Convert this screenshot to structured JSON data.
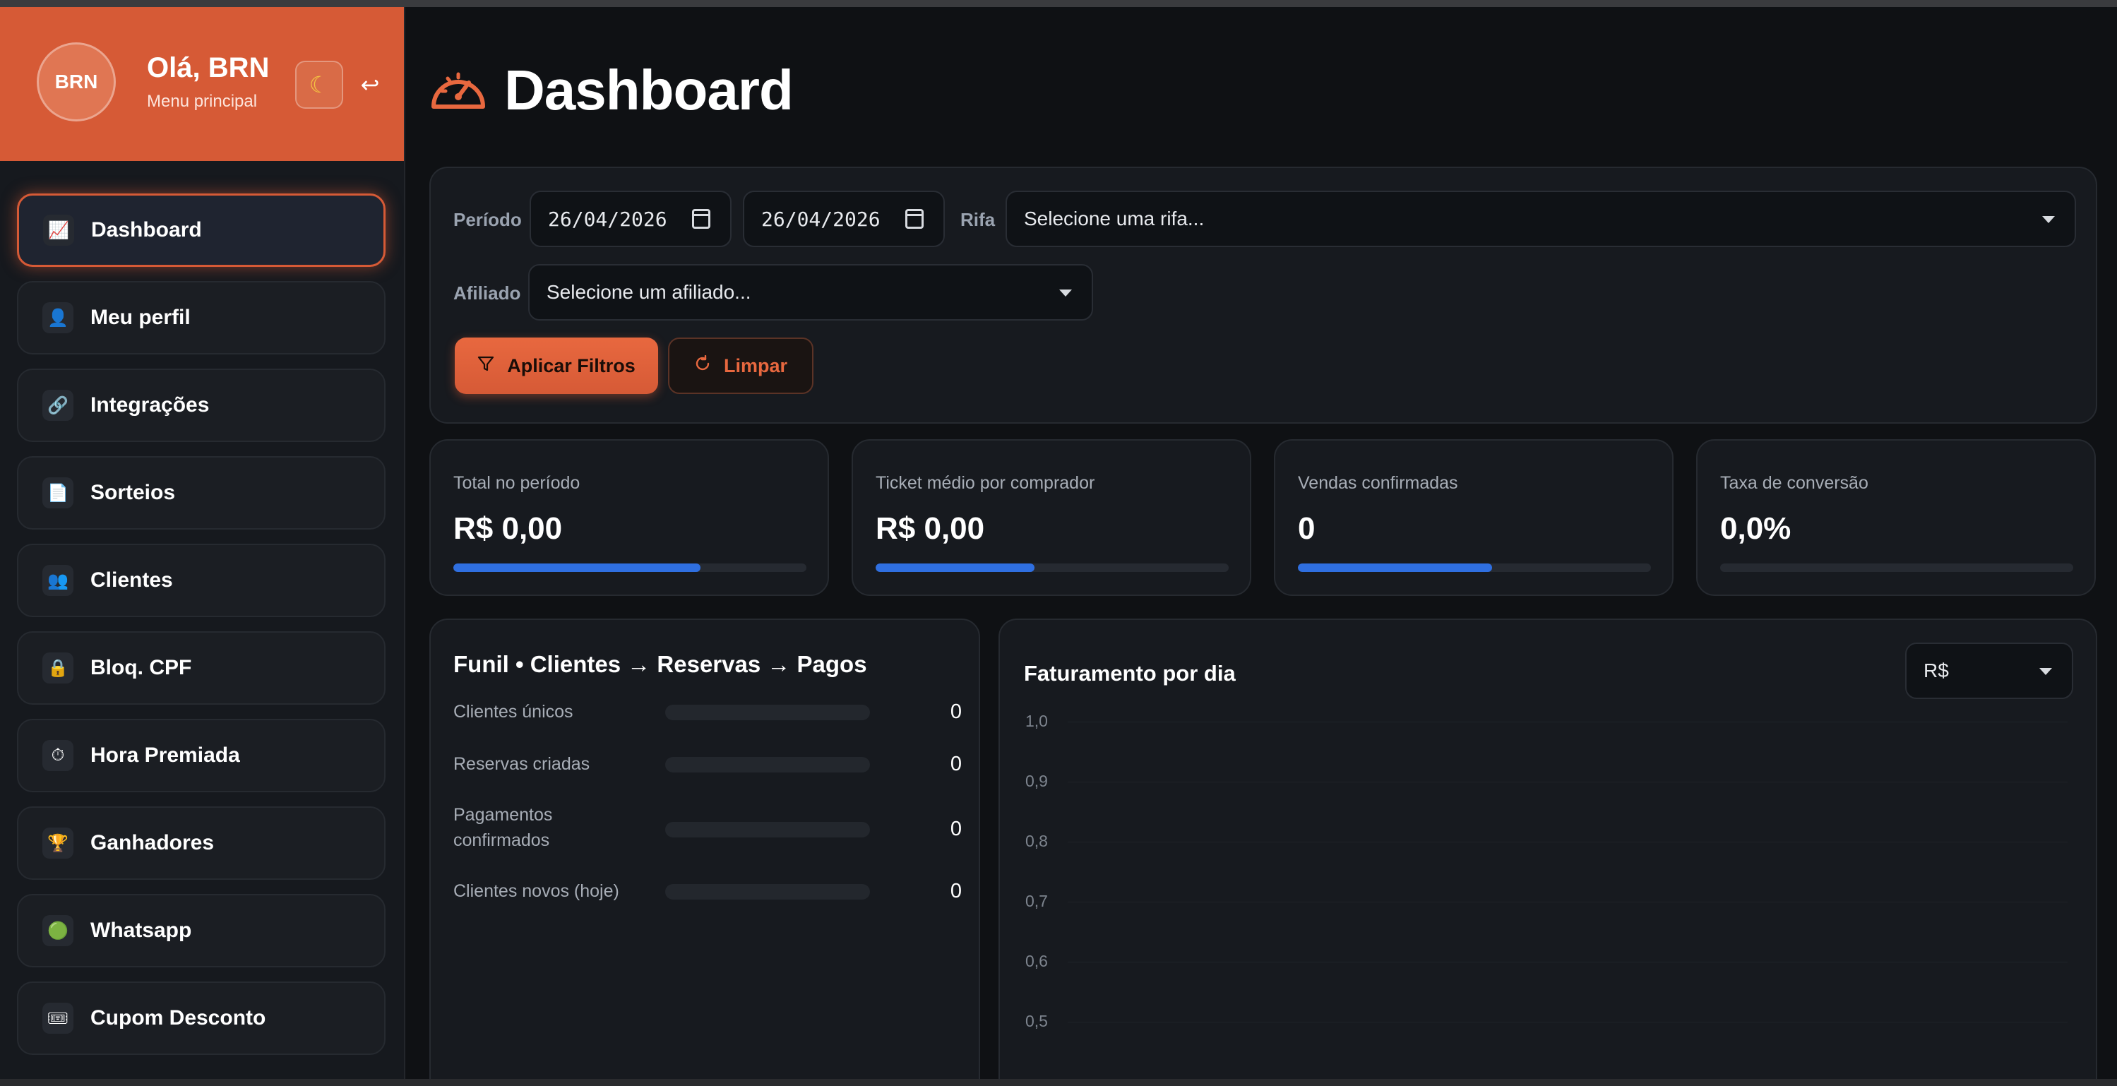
{
  "sidebar": {
    "avatar_initials": "BRN",
    "greeting": "Olá, BRN",
    "subtitle": "Menu principal",
    "theme_icon": "moon-icon",
    "logout_icon": "return-arrow-icon",
    "items": [
      {
        "label": "Dashboard",
        "icon": "chart-icon",
        "glyph": "📈",
        "active": true
      },
      {
        "label": "Meu perfil",
        "icon": "user-icon",
        "glyph": "👤"
      },
      {
        "label": "Integrações",
        "icon": "link-icon",
        "glyph": "🔗"
      },
      {
        "label": "Sorteios",
        "icon": "document-icon",
        "glyph": "📄"
      },
      {
        "label": "Clientes",
        "icon": "users-icon",
        "glyph": "👥"
      },
      {
        "label": "Bloq. CPF",
        "icon": "lock-icon",
        "glyph": "🔒"
      },
      {
        "label": "Hora Premiada",
        "icon": "stopwatch-icon",
        "glyph": "⏱"
      },
      {
        "label": "Ganhadores",
        "icon": "trophy-icon",
        "glyph": "🏆"
      },
      {
        "label": "Whatsapp",
        "icon": "green-circle-icon",
        "glyph": "🟢"
      },
      {
        "label": "Cupom Desconto",
        "icon": "ticket-icon",
        "glyph": "🎟"
      }
    ]
  },
  "header": {
    "title": "Dashboard",
    "icon": "speedometer-icon"
  },
  "filters": {
    "period_label": "Período",
    "date_start": "26/04/2026",
    "date_end": "26/04/2026",
    "raffle_label": "Rifa",
    "raffle_placeholder": "Selecione uma rifa...",
    "affiliate_label": "Afiliado",
    "affiliate_placeholder": "Selecione um afiliado...",
    "apply_label": "Aplicar Filtros",
    "clear_label": "Limpar"
  },
  "stats": [
    {
      "label": "Total no período",
      "value": "R$ 0,00",
      "progress": 0.7
    },
    {
      "label": "Ticket médio por comprador",
      "value": "R$ 0,00",
      "progress": 0.45
    },
    {
      "label": "Vendas confirmadas",
      "value": "0",
      "progress": 0.55
    },
    {
      "label": "Taxa de conversão",
      "value": "0,0%",
      "progress": 0
    }
  ],
  "funnel": {
    "title": "Funil • Clientes → Reservas → Pagos",
    "rows": [
      {
        "label": "Clientes únicos",
        "value": "0"
      },
      {
        "label": "Reservas criadas",
        "value": "0"
      },
      {
        "label": "Pagamentos confirmados",
        "value": "0"
      },
      {
        "label": "Clientes novos (hoje)",
        "value": "0"
      }
    ]
  },
  "revenue": {
    "title": "Faturamento por dia",
    "currency_select": "R$"
  },
  "chart_data": {
    "type": "line",
    "title": "Faturamento por dia",
    "x": [],
    "series": [],
    "yticks": [
      "1,0",
      "0,9",
      "0,8",
      "0,7",
      "0,6",
      "0,5"
    ],
    "ylim": [
      0.5,
      1.0
    ],
    "grid": true
  },
  "colors": {
    "accent": "#d65a36",
    "progress": "#2f6fe0",
    "background": "#0f1114",
    "card": "#171a1f"
  }
}
